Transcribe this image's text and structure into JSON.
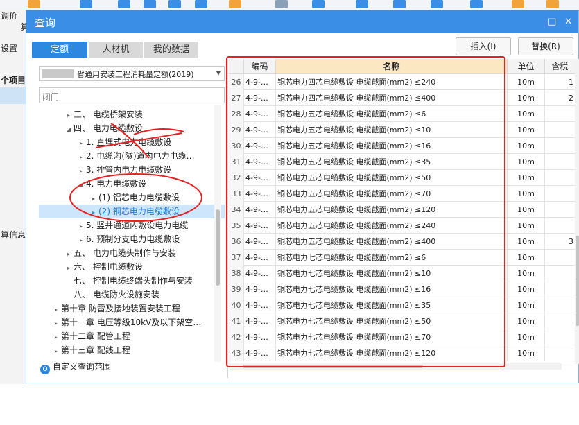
{
  "background": {
    "toolbar_texts": [
      "调价"
    ],
    "left_panel": [
      "设置",
      "个项目",
      "算信息"
    ],
    "left_bottom_text": "算"
  },
  "dialog": {
    "title": "查询",
    "restore_glyph": "□",
    "close_glyph": "✕",
    "tabs": [
      {
        "label": "定额",
        "active": true
      },
      {
        "label": "人材机",
        "active": false
      },
      {
        "label": "我的数据",
        "active": false
      }
    ],
    "insert_label": "插入(I)",
    "replace_label": "替换(R)",
    "quota_book": "省通用安装工程消耗量定额(2019)",
    "search_placeholder": "闭门",
    "custom_range_label": "自定义查询范围",
    "custom_range_icon": "search-icon",
    "accent_color": "#2f88e0",
    "annotation_color": "#e52222"
  },
  "tree": [
    {
      "label": "三、 电缆桥架安装",
      "level": 2,
      "caret": "▸"
    },
    {
      "label": "四、 电力电缆敷设",
      "level": 2,
      "caret": "◢"
    },
    {
      "label": "1. 直埋式电力电缆敷设",
      "level": 3,
      "caret": "▸"
    },
    {
      "label": "2. 电缆沟(隧)道内电力电缆…",
      "level": 3,
      "caret": "▸"
    },
    {
      "label": "3. 排管内电力电缆敷设",
      "level": 3,
      "caret": "▸"
    },
    {
      "label": "4. 电力电缆敷设",
      "level": 3,
      "caret": "◢"
    },
    {
      "label": "(1) 铝芯电力电缆敷设",
      "level": 4,
      "caret": "▸",
      "selected": false
    },
    {
      "label": "(2) 铜芯电力电缆敷设",
      "level": 4,
      "caret": "▸",
      "selected": true
    },
    {
      "label": "5. 竖井通道内敷设电力电缆",
      "level": 3,
      "caret": "▸"
    },
    {
      "label": "6. 预制分支电力电缆敷设",
      "level": 3,
      "caret": "▸"
    },
    {
      "label": "五、 电力电缆头制作与安装",
      "level": 2,
      "caret": "▸"
    },
    {
      "label": "六、 控制电缆敷设",
      "level": 2,
      "caret": "▸"
    },
    {
      "label": "七、 控制电缆终端头制作与安装",
      "level": 2,
      "caret": ""
    },
    {
      "label": "八、 电缆防火设施安装",
      "level": 2,
      "caret": ""
    },
    {
      "label": "第十章 防雷及接地装置安装工程",
      "level": 1,
      "caret": "▸"
    },
    {
      "label": "第十一章 电压等级10kV及以下架空…",
      "level": 1,
      "caret": "▸"
    },
    {
      "label": "第十二章 配管工程",
      "level": 1,
      "caret": "▸"
    },
    {
      "label": "第十三章 配线工程",
      "level": 1,
      "caret": "▸"
    }
  ],
  "grid": {
    "headers": {
      "num": "",
      "code": "编码",
      "name": "名称",
      "unit": "单位",
      "qty": "含稅"
    },
    "rows": [
      {
        "num": "26",
        "code": "4-9-…",
        "name": "铜芯电力四芯电缆敷设 电缆截面(mm2) ≤240",
        "unit": "10m",
        "qty": "1"
      },
      {
        "num": "27",
        "code": "4-9-…",
        "name": "铜芯电力四芯电缆敷设 电缆截面(mm2) ≤400",
        "unit": "10m",
        "qty": "2"
      },
      {
        "num": "28",
        "code": "4-9-…",
        "name": "铜芯电力五芯电缆敷设 电缆截面(mm2) ≤6",
        "unit": "10m",
        "qty": ""
      },
      {
        "num": "29",
        "code": "4-9-…",
        "name": "铜芯电力五芯电缆敷设 电缆截面(mm2) ≤10",
        "unit": "10m",
        "qty": ""
      },
      {
        "num": "30",
        "code": "4-9-…",
        "name": "铜芯电力五芯电缆敷设 电缆截面(mm2) ≤16",
        "unit": "10m",
        "qty": ""
      },
      {
        "num": "31",
        "code": "4-9-…",
        "name": "铜芯电力五芯电缆敷设 电缆截面(mm2) ≤35",
        "unit": "10m",
        "qty": ""
      },
      {
        "num": "32",
        "code": "4-9-…",
        "name": "铜芯电力五芯电缆敷设 电缆截面(mm2) ≤50",
        "unit": "10m",
        "qty": ""
      },
      {
        "num": "33",
        "code": "4-9-…",
        "name": "铜芯电力五芯电缆敷设 电缆截面(mm2) ≤70",
        "unit": "10m",
        "qty": ""
      },
      {
        "num": "34",
        "code": "4-9-…",
        "name": "铜芯电力五芯电缆敷设 电缆截面(mm2) ≤120",
        "unit": "10m",
        "qty": ""
      },
      {
        "num": "35",
        "code": "4-9-…",
        "name": "铜芯电力五芯电缆敷设 电缆截面(mm2) ≤240",
        "unit": "10m",
        "qty": ""
      },
      {
        "num": "36",
        "code": "4-9-…",
        "name": "铜芯电力五芯电缆敷设 电缆截面(mm2) ≤400",
        "unit": "10m",
        "qty": "3"
      },
      {
        "num": "37",
        "code": "4-9-…",
        "name": "铜芯电力七芯电缆敷设 电缆截面(mm2) ≤6",
        "unit": "10m",
        "qty": ""
      },
      {
        "num": "38",
        "code": "4-9-…",
        "name": "铜芯电力七芯电缆敷设 电缆截面(mm2) ≤10",
        "unit": "10m",
        "qty": ""
      },
      {
        "num": "39",
        "code": "4-9-…",
        "name": "铜芯电力七芯电缆敷设 电缆截面(mm2) ≤16",
        "unit": "10m",
        "qty": ""
      },
      {
        "num": "40",
        "code": "4-9-…",
        "name": "铜芯电力七芯电缆敷设 电缆截面(mm2) ≤35",
        "unit": "10m",
        "qty": ""
      },
      {
        "num": "41",
        "code": "4-9-…",
        "name": "铜芯电力七芯电缆敷设 电缆截面(mm2) ≤50",
        "unit": "10m",
        "qty": ""
      },
      {
        "num": "42",
        "code": "4-9-…",
        "name": "铜芯电力七芯电缆敷设 电缆截面(mm2) ≤70",
        "unit": "10m",
        "qty": ""
      },
      {
        "num": "43",
        "code": "4-9-…",
        "name": "铜芯电力七芯电缆敷设 电缆截面(mm2) ≤120",
        "unit": "10m",
        "qty": ""
      }
    ]
  }
}
